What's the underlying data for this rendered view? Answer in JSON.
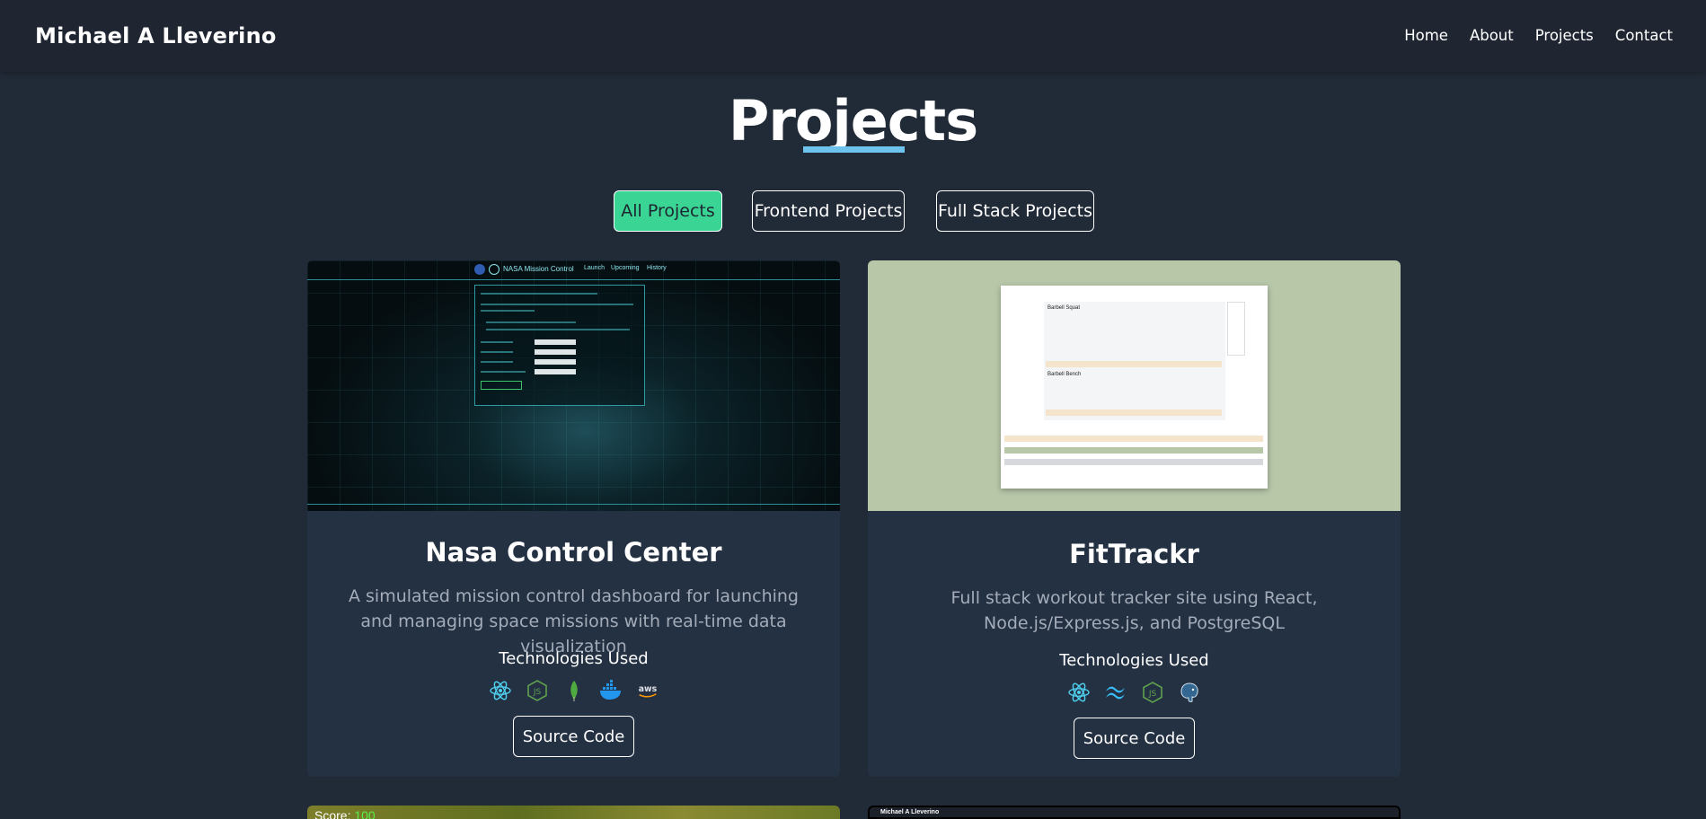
{
  "header": {
    "brand": "Michael A Lleverino",
    "nav": [
      "Home",
      "About",
      "Projects",
      "Contact"
    ]
  },
  "section": {
    "title": "Projects"
  },
  "filters": [
    "All Projects",
    "Frontend Projects",
    "Full Stack Projects"
  ],
  "active_filter": "All Projects",
  "colors": {
    "accent": "#6ec3ec",
    "active_filter": "#3ad595",
    "card_bg": "#243143",
    "page_bg": "#212a37"
  },
  "projects": [
    {
      "title": "Nasa Control Center",
      "description": "A simulated mission control dashboard for launching and managing space missions with real-time data visualization",
      "tech_label": "Technologies Used",
      "tech_icons": [
        "react-icon",
        "nodejs-icon",
        "mongodb-icon",
        "docker-icon",
        "aws-icon"
      ],
      "button": "Source Code",
      "screenshot": {
        "app_title": "NASA Mission Control",
        "nav": [
          "Launch",
          "Upcoming",
          "History"
        ]
      }
    },
    {
      "title": "FitTrackr",
      "description": "Full stack workout tracker site using React, Node.js/Express.js, and PostgreSQL",
      "tech_label": "Technologies Used",
      "tech_icons": [
        "react-icon",
        "tailwind-icon",
        "nodejs-icon",
        "postgresql-icon"
      ],
      "button": "Source Code",
      "screenshot": {
        "exercises": [
          "Barbell Squat",
          "Barbell Bench"
        ]
      }
    }
  ],
  "peek": {
    "game_score_label": "Score:",
    "game_score_value": "100",
    "site_brand": "Michael A Lleverino"
  }
}
